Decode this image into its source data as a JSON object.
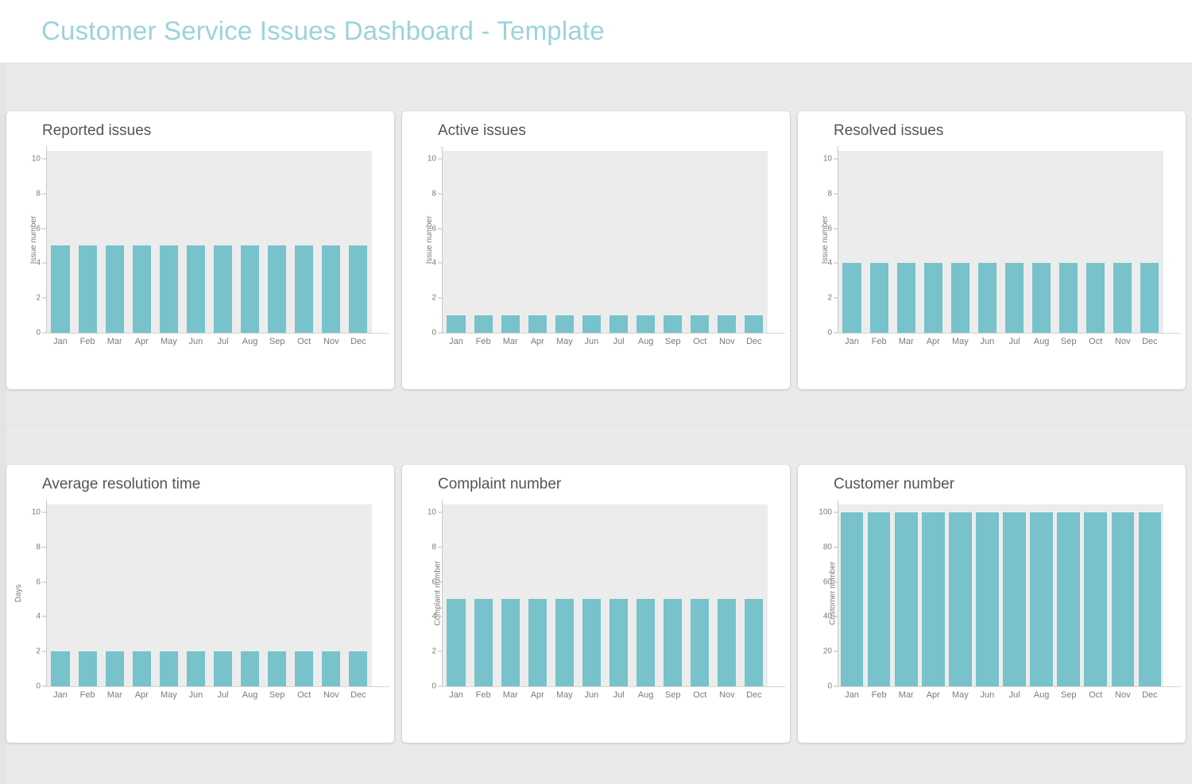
{
  "header": {
    "title": "Customer Service Issues Dashboard - Template",
    "title_color": "#9bd3dc"
  },
  "theme": {
    "bar_color": "#77c2cb",
    "plot_background": "#ececec",
    "page_background": "#eaeaea",
    "card_background": "#ffffff",
    "axis_text_color": "#7b7b7b",
    "chart_title_color": "#555555"
  },
  "months": [
    "Jan",
    "Feb",
    "Mar",
    "Apr",
    "May",
    "Jun",
    "Jul",
    "Aug",
    "Sep",
    "Oct",
    "Nov",
    "Dec"
  ],
  "chart_data": [
    {
      "type": "bar",
      "title": "Reported issues",
      "xlabel": "",
      "ylabel": "Issue number",
      "categories": [
        "Jan",
        "Feb",
        "Mar",
        "Apr",
        "May",
        "Jun",
        "Jul",
        "Aug",
        "Sep",
        "Oct",
        "Nov",
        "Dec"
      ],
      "values": [
        5,
        5,
        5,
        5,
        5,
        5,
        5,
        5,
        5,
        5,
        5,
        5
      ],
      "yticks": [
        0,
        2,
        4,
        6,
        8,
        10
      ],
      "ylim": [
        0,
        10.5
      ],
      "grid": false,
      "legend": "none"
    },
    {
      "type": "bar",
      "title": "Active issues",
      "xlabel": "",
      "ylabel": "Issue number",
      "categories": [
        "Jan",
        "Feb",
        "Mar",
        "Apr",
        "May",
        "Jun",
        "Jul",
        "Aug",
        "Sep",
        "Oct",
        "Nov",
        "Dec"
      ],
      "values": [
        1,
        1,
        1,
        1,
        1,
        1,
        1,
        1,
        1,
        1,
        1,
        1
      ],
      "yticks": [
        0,
        2,
        4,
        6,
        8,
        10
      ],
      "ylim": [
        0,
        10.5
      ],
      "grid": false,
      "legend": "none"
    },
    {
      "type": "bar",
      "title": "Resolved issues",
      "xlabel": "",
      "ylabel": "Issue number",
      "categories": [
        "Jan",
        "Feb",
        "Mar",
        "Apr",
        "May",
        "Jun",
        "Jul",
        "Aug",
        "Sep",
        "Oct",
        "Nov",
        "Dec"
      ],
      "values": [
        4,
        4,
        4,
        4,
        4,
        4,
        4,
        4,
        4,
        4,
        4,
        4
      ],
      "yticks": [
        0,
        2,
        4,
        6,
        8,
        10
      ],
      "ylim": [
        0,
        10.5
      ],
      "grid": false,
      "legend": "none"
    },
    {
      "type": "bar",
      "title": "Average resolution time",
      "xlabel": "",
      "ylabel": "Days",
      "categories": [
        "Jan",
        "Feb",
        "Mar",
        "Apr",
        "May",
        "Jun",
        "Jul",
        "Aug",
        "Sep",
        "Oct",
        "Nov",
        "Dec"
      ],
      "values": [
        2,
        2,
        2,
        2,
        2,
        2,
        2,
        2,
        2,
        2,
        2,
        2
      ],
      "yticks": [
        0,
        2,
        4,
        6,
        8,
        10
      ],
      "ylim": [
        0,
        10.5
      ],
      "grid": false,
      "legend": "none"
    },
    {
      "type": "bar",
      "title": "Complaint number",
      "xlabel": "",
      "ylabel": "Complaint number",
      "categories": [
        "Jan",
        "Feb",
        "Mar",
        "Apr",
        "May",
        "Jun",
        "Jul",
        "Aug",
        "Sep",
        "Oct",
        "Nov",
        "Dec"
      ],
      "values": [
        5,
        5,
        5,
        5,
        5,
        5,
        5,
        5,
        5,
        5,
        5,
        5
      ],
      "yticks": [
        0,
        2,
        4,
        6,
        8,
        10
      ],
      "ylim": [
        0,
        10.5
      ],
      "grid": false,
      "legend": "none"
    },
    {
      "type": "bar",
      "title": "Customer number",
      "xlabel": "",
      "ylabel": "Customer number",
      "categories": [
        "Jan",
        "Feb",
        "Mar",
        "Apr",
        "May",
        "Jun",
        "Jul",
        "Aug",
        "Sep",
        "Oct",
        "Nov",
        "Dec"
      ],
      "values": [
        100,
        100,
        100,
        100,
        100,
        100,
        100,
        100,
        100,
        100,
        100,
        100
      ],
      "yticks": [
        0,
        20,
        40,
        60,
        80,
        100
      ],
      "ylim": [
        0,
        105
      ],
      "grid": false,
      "legend": "none",
      "wide_bars": true
    }
  ]
}
